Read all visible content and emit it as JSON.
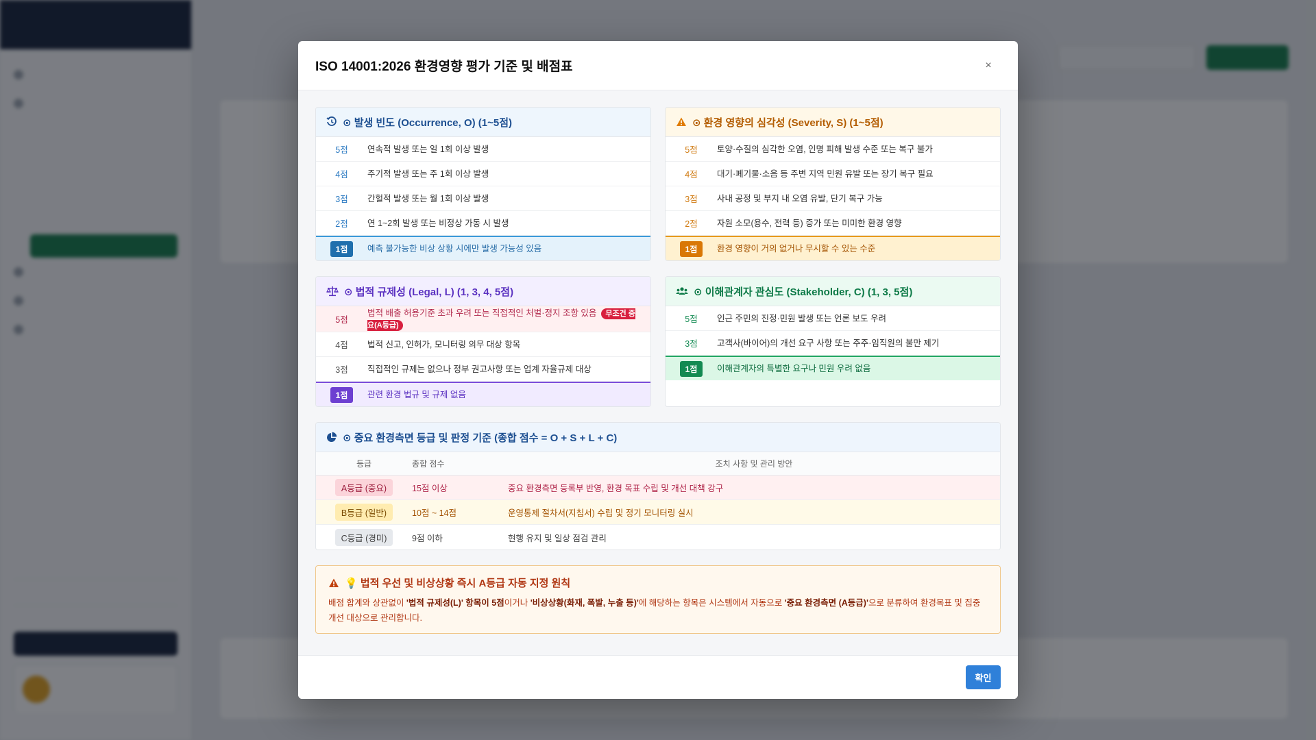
{
  "modal": {
    "title": "ISO 14001:2026 환경영향 평가 기준 및 배점표",
    "close": "×",
    "confirm": "확인"
  },
  "occurrence": {
    "title": "⊙ 발생 빈도 (Occurrence, O) (1~5점)",
    "icon": "history-icon",
    "rows": [
      {
        "score": "5점",
        "text": "연속적 발생 또는 일 1회 이상 발생"
      },
      {
        "score": "4점",
        "text": "주기적 발생 또는 주 1회 이상 발생"
      },
      {
        "score": "3점",
        "text": "간헐적 발생 또는 월 1회 이상 발생"
      },
      {
        "score": "2점",
        "text": "연 1~2회 발생 또는 비정상 가동 시 발생"
      },
      {
        "score": "1점",
        "text": "예측 불가능한 비상 상황 시에만 발생 가능성 있음"
      }
    ]
  },
  "severity": {
    "title": "⊙ 환경 영향의 심각성 (Severity, S) (1~5점)",
    "icon": "warning-icon",
    "rows": [
      {
        "score": "5점",
        "text": "토양·수질의 심각한 오염, 인명 피해 발생 수준 또는 복구 불가"
      },
      {
        "score": "4점",
        "text": "대기·폐기물·소음 등 주변 지역 민원 유발 또는 장기 복구 필요"
      },
      {
        "score": "3점",
        "text": "사내 공정 및 부지 내 오염 유발, 단기 복구 가능"
      },
      {
        "score": "2점",
        "text": "자원 소모(용수, 전력 등) 증가 또는 미미한 환경 영향"
      },
      {
        "score": "1점",
        "text": "환경 영향이 거의 없거나 무시할 수 있는 수준"
      }
    ]
  },
  "legal": {
    "title": "⊙ 법적 규제성 (Legal, L) (1, 3, 4, 5점)",
    "icon": "scale-icon",
    "badge": "무조건 중요(A등급)",
    "rows": [
      {
        "score": "5점",
        "text": "법적 배출 허용기준 초과 우려 또는 직접적인 처벌·정지 조항 있음"
      },
      {
        "score": "4점",
        "text": "법적 신고, 인허가, 모니터링 의무 대상 항목"
      },
      {
        "score": "3점",
        "text": "직접적인 규제는 없으나 정부 권고사항 또는 업계 자율규제 대상"
      },
      {
        "score": "1점",
        "text": "관련 환경 법규 및 규제 없음"
      }
    ]
  },
  "stakeholder": {
    "title": "⊙ 이해관계자 관심도 (Stakeholder, C) (1, 3, 5점)",
    "icon": "users-icon",
    "rows": [
      {
        "score": "5점",
        "text": "인근 주민의 진정·민원 발생 또는 언론 보도 우려"
      },
      {
        "score": "3점",
        "text": "고객사(바이어)의 개선 요구 사항 또는 주주·임직원의 불만 제기"
      },
      {
        "score": "1점",
        "text": "이해관계자의 특별한 요구나 민원 우려 없음"
      }
    ]
  },
  "grade": {
    "title": "⊙ 중요 환경측면 등급 및 판정 기준 (종합 점수 = O + S + L + C)",
    "icon": "pie-chart-icon",
    "headers": [
      "등급",
      "종합 점수",
      "조치 사항 및 관리 방안"
    ],
    "rows": [
      {
        "grade": "A등급 (중요)",
        "score": "15점 이상",
        "action": "중요 환경측면 등록부 반영, 환경 목표 수립 및 개선 대책 강구"
      },
      {
        "grade": "B등급 (일반)",
        "score": "10점 ~ 14점",
        "action": "운영통제 절차서(지침서) 수립 및 정기 모니터링 실시"
      },
      {
        "grade": "C등급 (경미)",
        "score": "9점 이하",
        "action": "현행 유지 및 일상 점검 관리"
      }
    ]
  },
  "notice": {
    "title": "💡 법적 우선 및 비상상황 즉시 A등급 자동 지정 원칙",
    "t1": "배점 합계와 상관없이 ",
    "b1": "'법적 규제성(L)' 항목이 5점",
    "t2": "이거나 ",
    "b2": "'비상상황(화재, 폭발, 누출 등)'",
    "t3": "에 해당하는 항목은 시스템에서 자동으로 ",
    "b3": "'중요 환경측면 (A등급)'",
    "t4": "으로 분류하여 환경목표 및 집중 개선 대상으로 관리합니다."
  },
  "colors": {
    "primary": "#2f80d9",
    "occurrence": "#1d4f91",
    "severity": "#b35c00",
    "legal": "#5b32c1",
    "stakeholder": "#0d7a47",
    "danger": "#d8203f"
  }
}
